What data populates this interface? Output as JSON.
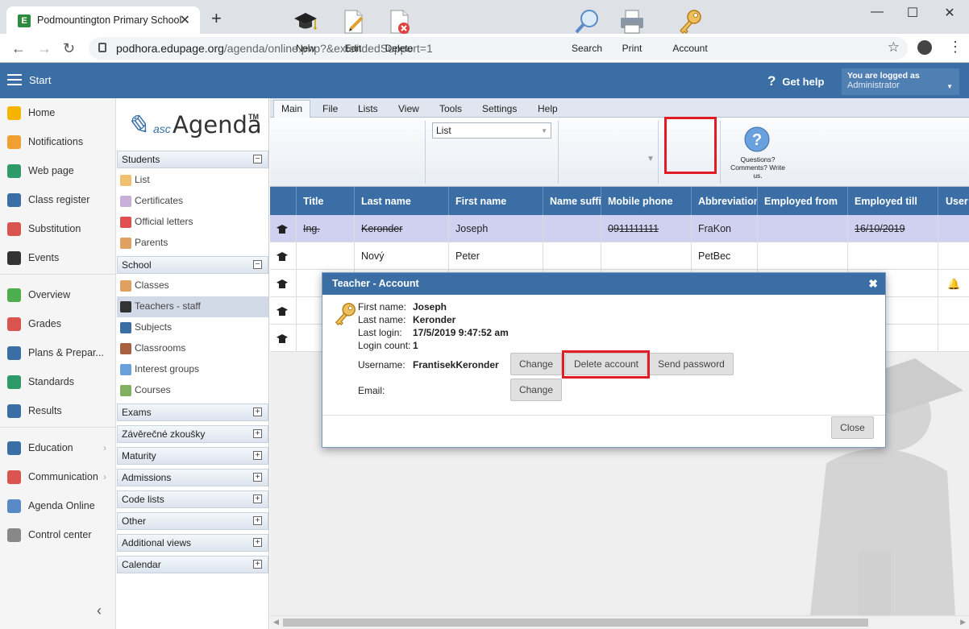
{
  "browser": {
    "tab_title": "Podmountington Primary School",
    "favicon_letter": "E",
    "new_tab": "+",
    "url_host": "podhora.edupage.org",
    "url_path": "/agenda/online.php?&extendedSupport=1",
    "window_min": "—",
    "window_max": "☐",
    "window_close": "✕"
  },
  "header": {
    "start_label": "Start",
    "help_label": "Get help",
    "logged_label": "You are logged as",
    "logged_user": "Administrator"
  },
  "leftnav": {
    "items": [
      {
        "label": "Home",
        "icon": "star-icon",
        "color": "#f5b400"
      },
      {
        "label": "Notifications",
        "icon": "envelope-icon",
        "color": "#f0a030"
      },
      {
        "label": "Web page",
        "icon": "house-icon",
        "color": "#2e9a6a"
      },
      {
        "label": "Class register",
        "icon": "book-icon",
        "color": "#3a6ea5"
      },
      {
        "label": "Substitution",
        "icon": "person-icon",
        "color": "#d9534f"
      },
      {
        "label": "Events",
        "icon": "calendar-icon",
        "color": "#333333"
      },
      {
        "label": "Overview",
        "icon": "check-circle-icon",
        "color": "#4cae4c"
      },
      {
        "label": "Grades",
        "icon": "grades-icon",
        "color": "#d9534f"
      },
      {
        "label": "Plans & Prepar...",
        "icon": "briefcase-icon",
        "color": "#3a6ea5"
      },
      {
        "label": "Standards",
        "icon": "shield-check-icon",
        "color": "#2e9a6a"
      },
      {
        "label": "Results",
        "icon": "bar-chart-icon",
        "color": "#3a6ea5"
      },
      {
        "label": "Education",
        "icon": "open-book-icon",
        "color": "#3a6ea5"
      },
      {
        "label": "Communication",
        "icon": "chat-icon",
        "color": "#d9534f"
      },
      {
        "label": "Agenda Online",
        "icon": "pen-icon",
        "color": "#5a8ac6"
      },
      {
        "label": "Control center",
        "icon": "gear-icon",
        "color": "#888888"
      }
    ]
  },
  "logo": {
    "asc": "asc",
    "agenda": "Agenda",
    "tm": "TM"
  },
  "sidebar": {
    "students": "Students",
    "students_items": [
      "List",
      "Certificates",
      "Official letters",
      "Parents"
    ],
    "school": "School",
    "school_items": [
      "Classes",
      "Teachers - staff",
      "Subjects",
      "Classrooms",
      "Interest groups",
      "Courses"
    ],
    "sections": [
      "Exams",
      "Závěrečné zkoušky",
      "Maturity",
      "Admissions",
      "Code lists",
      "Other",
      "Additional views",
      "Calendar"
    ]
  },
  "menu": {
    "tabs": [
      "Main",
      "File",
      "Lists",
      "View",
      "Tools",
      "Settings",
      "Help"
    ]
  },
  "ribbon": {
    "new": "New",
    "edit": "Edit",
    "delete": "Delete",
    "list_select": "List",
    "search": "Search",
    "print": "Print",
    "account": "Account",
    "questions": "Questions? Comments? Write us."
  },
  "grid": {
    "columns": [
      "Title",
      "Last name",
      "First name",
      "Name suffix",
      "Mobile phone",
      "Abbreviation",
      "Employed from",
      "Employed till",
      "User"
    ],
    "rows": [
      {
        "title": "Ing.",
        "last": "Keronder",
        "first": "Joseph",
        "suffix": "",
        "mobile": "0911111111",
        "abbr": "FraKon",
        "from": "",
        "till": "16/10/2019",
        "selected": true
      },
      {
        "title": "",
        "last": "Nový",
        "first": "Peter",
        "suffix": "",
        "mobile": "",
        "abbr": "PetBec",
        "from": "",
        "till": "",
        "selected": false
      },
      {
        "title": "",
        "last": "",
        "first": "",
        "suffix": "",
        "mobile": "",
        "abbr": "",
        "from": "",
        "till": "",
        "selected": false
      },
      {
        "title": "",
        "last": "",
        "first": "",
        "suffix": "",
        "mobile": "",
        "abbr": "",
        "from": "",
        "till": "",
        "selected": false
      },
      {
        "title": "",
        "last": "",
        "first": "",
        "suffix": "",
        "mobile": "",
        "abbr": "",
        "from": "",
        "till": "",
        "selected": false
      }
    ]
  },
  "dialog": {
    "title": "Teacher - Account",
    "first_name_label": "First name:",
    "first_name": "Joseph",
    "last_name_label": "Last name:",
    "last_name": "Keronder",
    "last_login_label": "Last login:",
    "last_login": "17/5/2019 9:47:52 am",
    "login_count_label": "Login count:",
    "login_count": "1",
    "username_label": "Username:",
    "username": "FrantisekKeronder",
    "email_label": "Email:",
    "change": "Change",
    "delete_account": "Delete account",
    "send_password": "Send password",
    "close": "Close"
  }
}
